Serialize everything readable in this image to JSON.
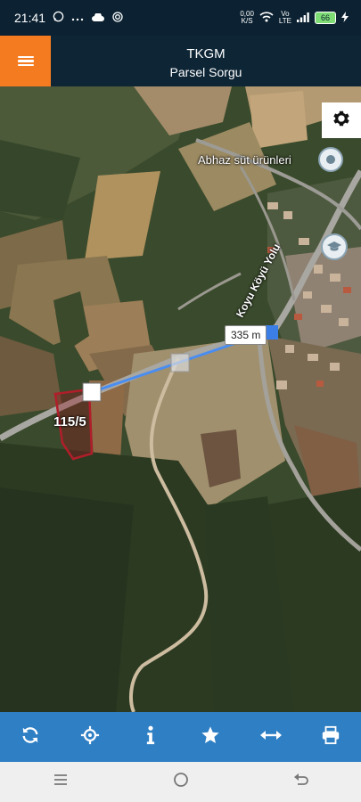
{
  "status_bar": {
    "time": "21:41",
    "net_speed_value": "0,00",
    "net_speed_unit": "K/S",
    "volte_top": "Vo",
    "volte_bottom": "LTE",
    "battery": "66"
  },
  "header": {
    "title": "TKGM",
    "subtitle": "Parsel Sorgu"
  },
  "map": {
    "poi_label": "Abhaz süt ürünleri",
    "distance_label": "335 m",
    "parcel_label": "115/5",
    "road_label": "Koyu Köyü Yolu",
    "measure_line_color": "#4a8df0",
    "parcel_outline_color": "#b01e2a"
  },
  "toolbar": {
    "icons": [
      "refresh-icon",
      "locate-icon",
      "info-icon",
      "star-icon",
      "measure-icon",
      "print-icon"
    ]
  },
  "nav_bar": {
    "icons": [
      "recent-apps-icon",
      "home-icon",
      "back-icon"
    ]
  }
}
